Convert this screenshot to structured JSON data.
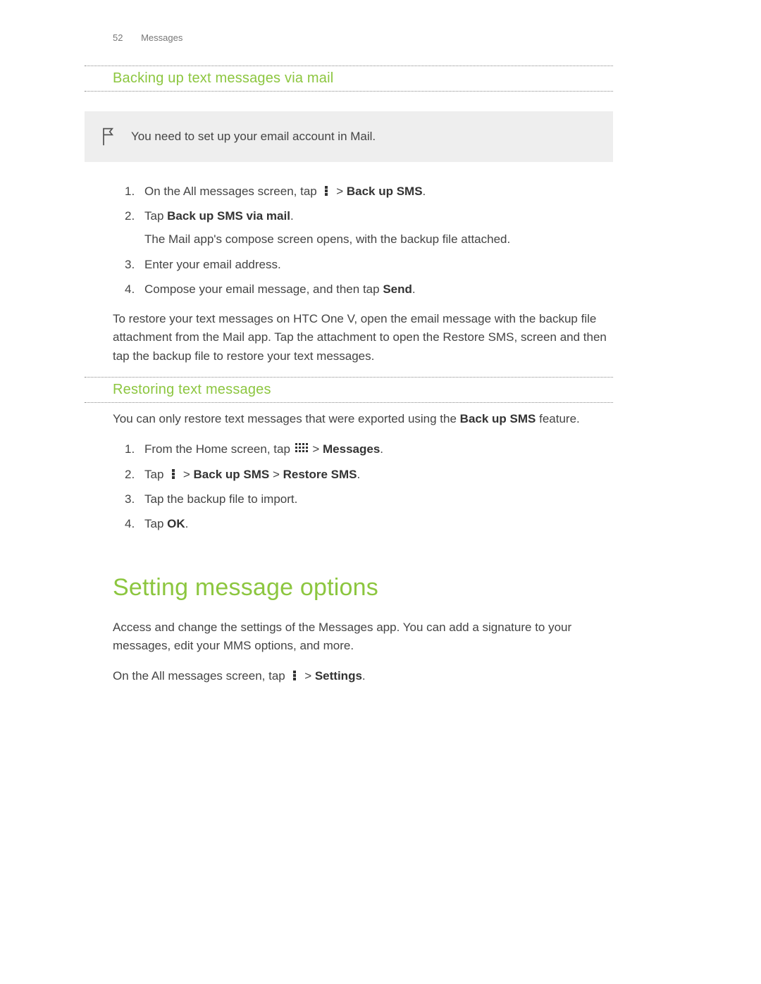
{
  "header": {
    "page_number": "52",
    "chapter": "Messages"
  },
  "section1": {
    "title": "Backing up text messages via mail",
    "note": "You need to set up your email account in Mail.",
    "steps": {
      "s1_pre": "On the All messages screen, tap ",
      "s1_post": " > ",
      "s1_bold": "Back up SMS",
      "s1_end": ".",
      "s2_pre": "Tap ",
      "s2_bold": "Back up SMS via mail",
      "s2_end": ".",
      "s2_sub": "The Mail app's compose screen opens, with the backup file attached.",
      "s3": "Enter your email address.",
      "s4_pre": "Compose your email message, and then tap ",
      "s4_bold": "Send",
      "s4_end": "."
    },
    "restore_para": "To restore your text messages on HTC One V, open the email message with the backup file attachment from the Mail app. Tap the attachment to open the Restore SMS, screen and then tap the backup file to restore your text messages."
  },
  "section2": {
    "title": "Restoring text messages",
    "intro_pre": "You can only restore text messages that were exported using the ",
    "intro_bold": "Back up SMS",
    "intro_post": " feature.",
    "steps": {
      "s1_pre": "From the Home screen, tap ",
      "s1_post": " > ",
      "s1_bold": "Messages",
      "s1_end": ".",
      "s2_pre": "Tap ",
      "s2_mid1": " > ",
      "s2_bold1": "Back up SMS",
      "s2_mid2": " > ",
      "s2_bold2": "Restore SMS",
      "s2_end": ".",
      "s3": "Tap the backup file to import.",
      "s4_pre": "Tap ",
      "s4_bold": "OK",
      "s4_end": "."
    }
  },
  "section3": {
    "title": "Setting message options",
    "para": "Access and change the settings of the Messages app. You can add a signature to your messages, edit your MMS options, and more.",
    "line2_pre": "On the All messages screen, tap ",
    "line2_mid": " > ",
    "line2_bold": "Settings",
    "line2_end": "."
  }
}
